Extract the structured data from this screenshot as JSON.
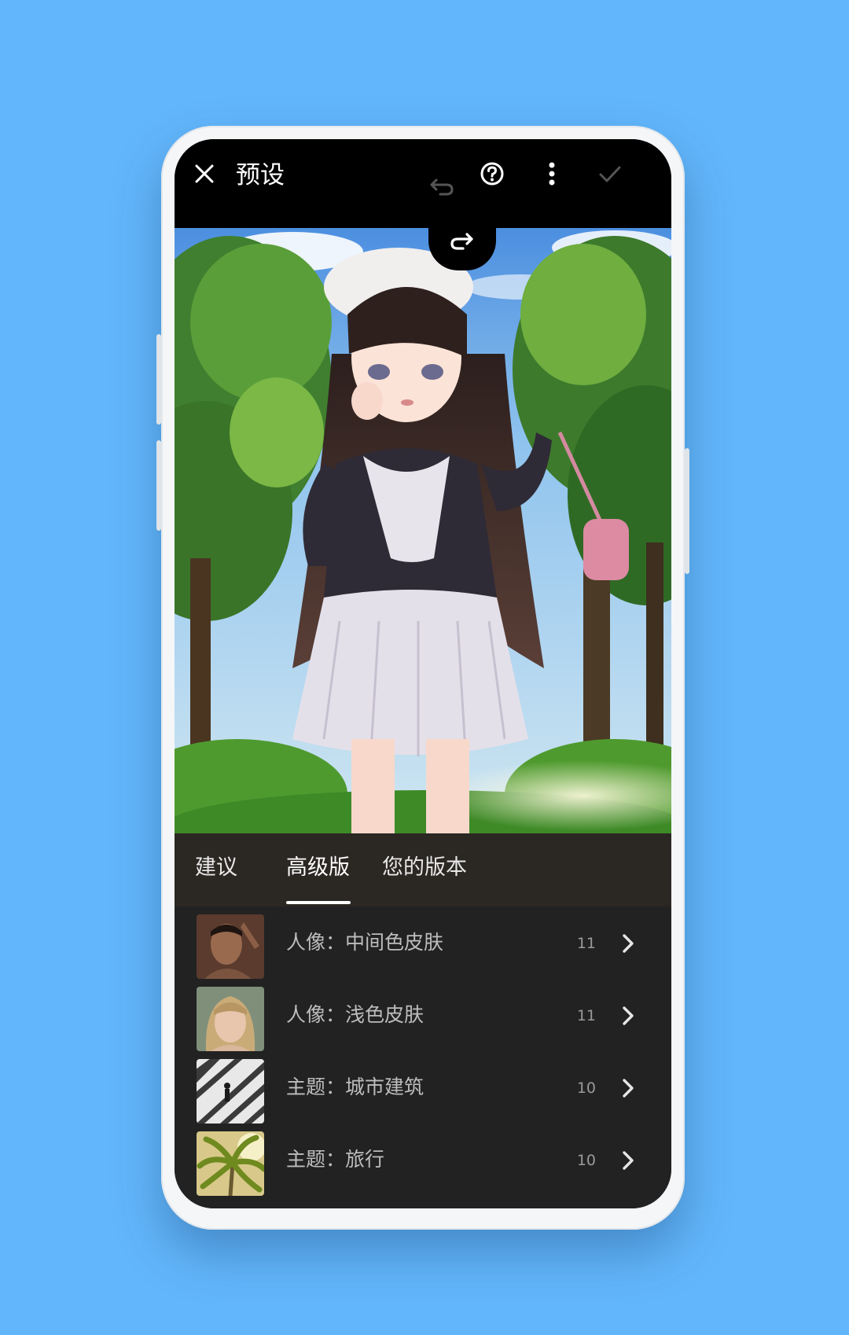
{
  "header": {
    "title": "预设",
    "close_icon": "close-icon",
    "undo_icon": "undo-icon",
    "redo_icon": "redo-icon",
    "help_icon": "help-icon",
    "more_icon": "more-vertical-icon",
    "confirm_icon": "check-icon"
  },
  "tabs": [
    {
      "label": "建议"
    },
    {
      "label": "高级版"
    },
    {
      "label": "您的版本"
    }
  ],
  "presets": [
    {
      "label": "人像：中间色皮肤",
      "count": "11"
    },
    {
      "label": "人像：浅色皮肤",
      "count": "11"
    },
    {
      "label": "主题：城市建筑",
      "count": "10"
    },
    {
      "label": "主题：旅行",
      "count": "10"
    }
  ],
  "colors": {
    "background": "#62b6fb",
    "topbar": "#000000",
    "panel": "#222222",
    "tab_active": "#ffffff"
  }
}
